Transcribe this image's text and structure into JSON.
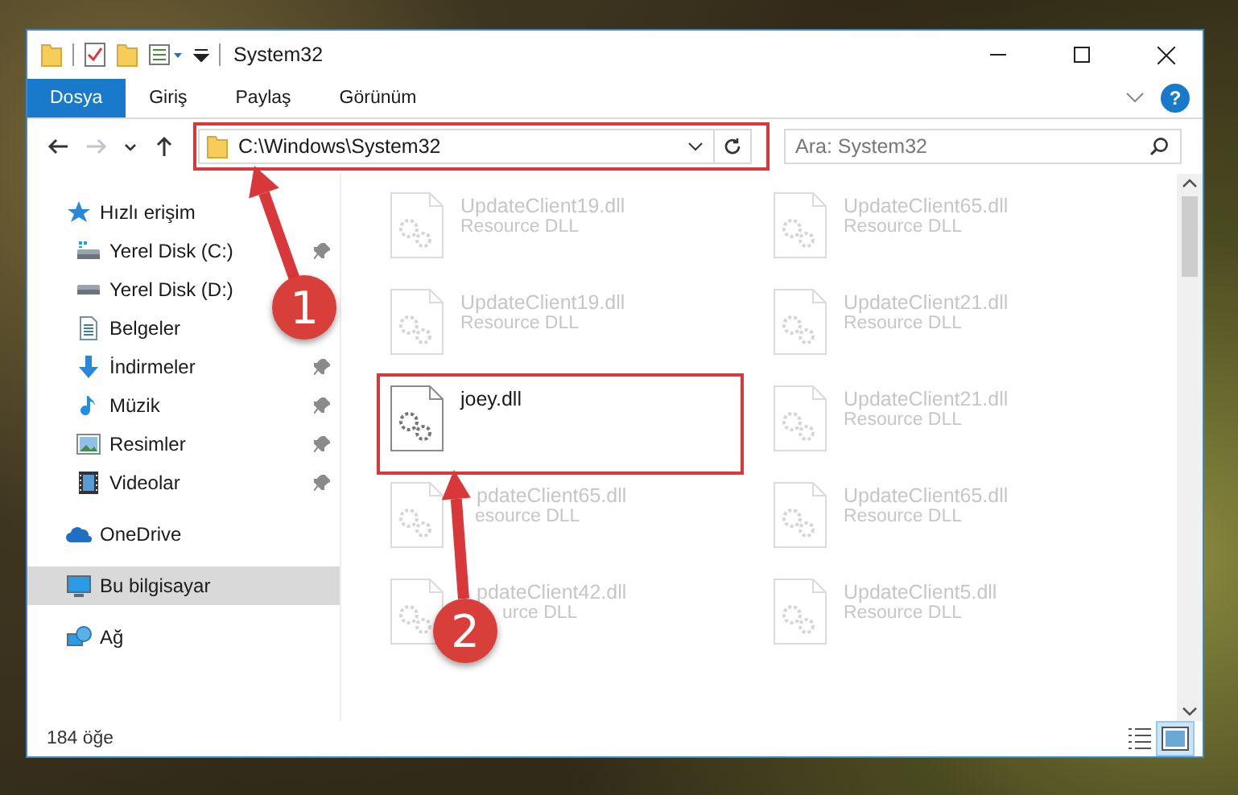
{
  "window": {
    "title": "System32"
  },
  "ribbon_tabs": [
    {
      "label": "Dosya",
      "kind": "file"
    },
    {
      "label": "Giriş",
      "kind": "tab"
    },
    {
      "label": "Paylaş",
      "kind": "tab"
    },
    {
      "label": "Görünüm",
      "kind": "tab"
    }
  ],
  "help": "?",
  "nav_buttons": [
    {
      "kind": "back",
      "disabled": false
    },
    {
      "kind": "forward",
      "disabled": true
    },
    {
      "kind": "recent",
      "disabled": false
    },
    {
      "kind": "up",
      "disabled": false
    }
  ],
  "address": {
    "path": "C:\\Windows\\System32"
  },
  "search": {
    "placeholder": "Ara: System32"
  },
  "sidebar": {
    "items": [
      {
        "label": "Hızlı erişim",
        "kind": "star",
        "selected": false,
        "children": [
          {
            "label": "Yerel Disk (C:)",
            "kind": "drive-windows",
            "pinned": true
          },
          {
            "label": "Yerel Disk (D:)",
            "kind": "drive",
            "pinned": false
          },
          {
            "label": "Belgeler",
            "kind": "documents",
            "pinned": false
          },
          {
            "label": "İndirmeler",
            "kind": "download",
            "pinned": true
          },
          {
            "label": "Müzik",
            "kind": "music",
            "pinned": true
          },
          {
            "label": "Resimler",
            "kind": "pictures",
            "pinned": true
          },
          {
            "label": "Videolar",
            "kind": "videos",
            "pinned": true
          }
        ]
      },
      {
        "label": "OneDrive",
        "kind": "cloud",
        "selected": false
      },
      {
        "label": "Bu bilgisayar",
        "kind": "computer",
        "selected": true
      },
      {
        "label": "Ağ",
        "kind": "network",
        "selected": false
      }
    ]
  },
  "files": [
    {
      "name": "UpdateClient19.dll",
      "type": "Resource DLL",
      "dimmed": true
    },
    {
      "name": "UpdateClient65.dll",
      "type": "Resource DLL",
      "dimmed": true
    },
    {
      "name": "UpdateClient19.dll",
      "type": "Resource DLL",
      "dimmed": true
    },
    {
      "name": "UpdateClient21.dll",
      "type": "Resource DLL",
      "dimmed": true
    },
    {
      "name": "joey.dll",
      "dimmed": false
    },
    {
      "name": "UpdateClient21.dll",
      "type": "Resource DLL",
      "dimmed": true
    },
    {
      "name": "pdateClient65.dll",
      "type": "esource DLL",
      "dimmed": true
    },
    {
      "name": "UpdateClient65.dll",
      "type": "Resource DLL",
      "dimmed": true
    },
    {
      "name": "pdateClient42.dll",
      "type": "urce DLL",
      "dimmed": true
    },
    {
      "name": "UpdateClient5.dll",
      "type": "Resource DLL",
      "dimmed": true
    }
  ],
  "status_bar": {
    "count": "184 öğe",
    "views": [
      {
        "kind": "details",
        "selected": false
      },
      {
        "kind": "large-icons",
        "selected": true
      }
    ]
  },
  "annotations": {
    "markers": [
      {
        "number": "1"
      },
      {
        "number": "2"
      }
    ]
  }
}
